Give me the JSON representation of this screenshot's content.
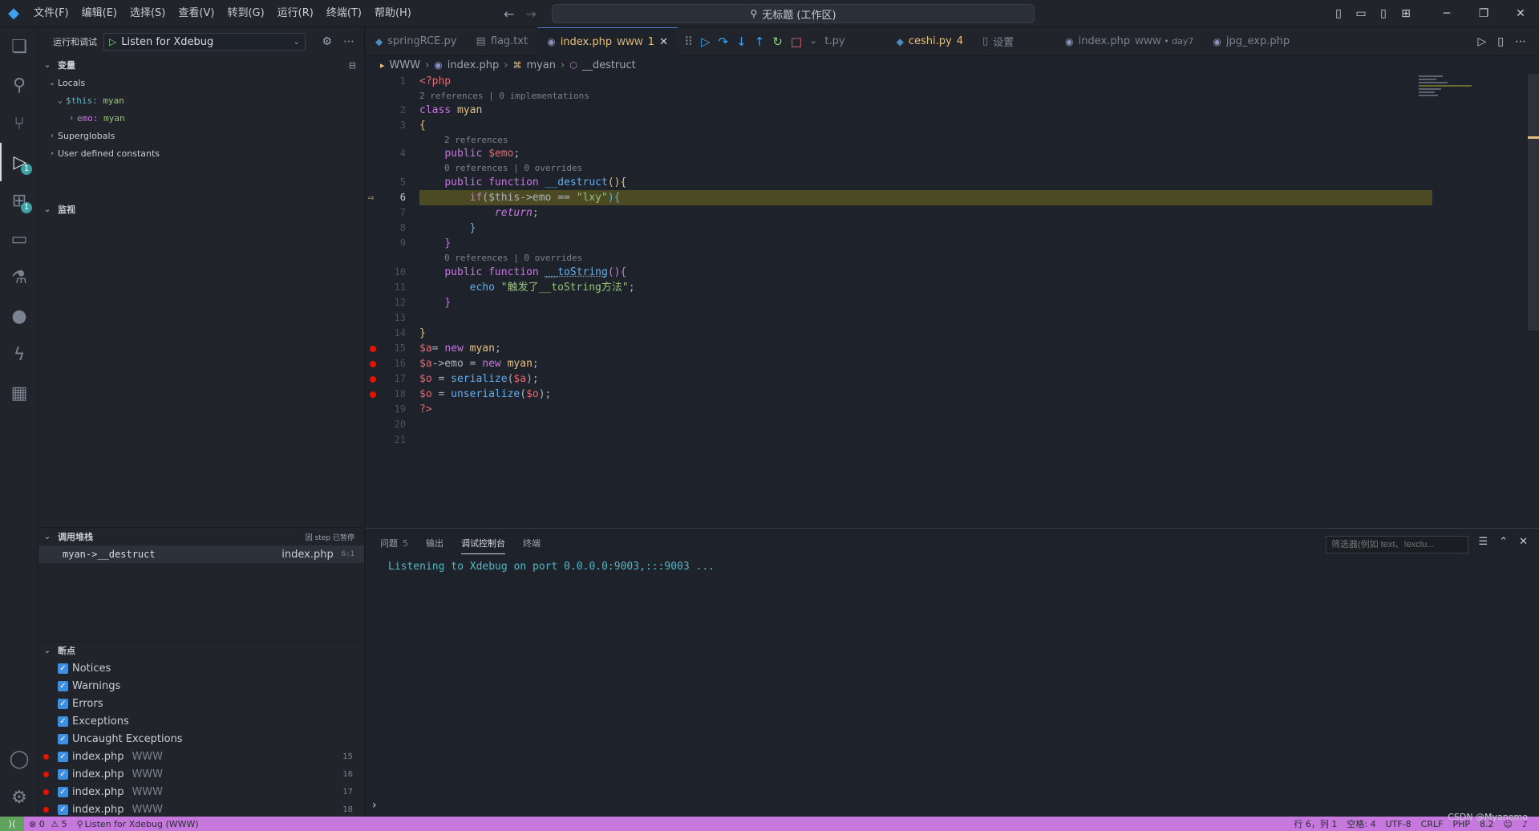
{
  "titlebar": {
    "menus": [
      "文件(F)",
      "编辑(E)",
      "选择(S)",
      "查看(V)",
      "转到(G)",
      "运行(R)",
      "终端(T)",
      "帮助(H)"
    ],
    "search": "无标题 (工作区)"
  },
  "activity": {
    "debug_badge": "1",
    "extensions_badge": "1"
  },
  "sidebar": {
    "title": "运行和调试",
    "config": "Listen for Xdebug",
    "variables_title": "变量",
    "locals": "Locals",
    "this_name": "$this:",
    "this_val": "myan",
    "emo_name": "emo:",
    "emo_val": "myan",
    "superglobals": "Superglobals",
    "user_constants": "User defined constants",
    "watch_title": "监视",
    "callstack_title": "调用堆栈",
    "callstack_status": "因 step 已暂停",
    "callstack_frame": "myan->__destruct",
    "callstack_file": "index.php",
    "callstack_pos": "6:1",
    "breakpoints_title": "断点",
    "breakpoints": [
      {
        "label": "Notices"
      },
      {
        "label": "Warnings"
      },
      {
        "label": "Errors"
      },
      {
        "label": "Exceptions"
      },
      {
        "label": "Uncaught Exceptions"
      }
    ],
    "file_breakpoints": [
      {
        "file": "index.php",
        "dir": "WWW",
        "line": "15"
      },
      {
        "file": "index.php",
        "dir": "WWW",
        "line": "16"
      },
      {
        "file": "index.php",
        "dir": "WWW",
        "line": "17"
      },
      {
        "file": "index.php",
        "dir": "WWW",
        "line": "18"
      }
    ]
  },
  "tabs": [
    {
      "label": "springRCE.py"
    },
    {
      "label": "flag.txt"
    },
    {
      "label": "index.php",
      "tag": "WWW",
      "num": "1"
    },
    {
      "label": "t.py"
    },
    {
      "label": "ceshi.py",
      "num": "4"
    },
    {
      "label": "设置"
    },
    {
      "label": "index.php",
      "tag": "WWW • day7"
    },
    {
      "label": "jpg_exp.php"
    }
  ],
  "breadcrumb": [
    "WWW",
    "index.php",
    "myan",
    "__destruct"
  ],
  "editor": {
    "lens": {
      "l1": "2 references | 0 implementations",
      "l4": "2 references",
      "l5": "0 references | 0 overrides",
      "l10": "0 references | 0 overrides"
    },
    "lines": {
      "n1": "1",
      "n2": "2",
      "n3": "3",
      "n4": "4",
      "n5": "5",
      "n6": "6",
      "n7": "7",
      "n8": "8",
      "n9": "9",
      "n10": "10",
      "n11": "11",
      "n12": "12",
      "n13": "13",
      "n14": "14",
      "n15": "15",
      "n16": "16",
      "n17": "17",
      "n18": "18",
      "n19": "19",
      "n20": "20",
      "n21": "21"
    },
    "code": {
      "c1": "<?php",
      "c2a": "class",
      "c2b": "myan",
      "c3": "{",
      "c4a": "public",
      "c4b": "$emo",
      "c4c": ";",
      "c5a": "public",
      "c5b": "function",
      "c5c": "__destruct",
      "c5d": "(){",
      "c6a": "if",
      "c6b": "($this",
      "c6c": "->emo == ",
      "c6d": "\"lxy\"",
      "c6e": "){",
      "c7a": "return",
      "c7b": ";",
      "c8": "}",
      "c9": "}",
      "c10a": "public",
      "c10b": "function",
      "c10c": "__toString",
      "c10d": "(){",
      "c11a": "echo",
      "c11b": "\"触发了__toString方法\"",
      "c11c": ";",
      "c12": "}",
      "c14": "}",
      "c15a": "$a",
      "c15b": "= ",
      "c15c": "new",
      "c15d": "myan",
      "c15e": ";",
      "c16a": "$a",
      "c16b": "->emo = ",
      "c16c": "new",
      "c16d": "myan",
      "c16e": ";",
      "c17a": "$o",
      "c17b": " = ",
      "c17c": "serialize",
      "c17d": "(",
      "c17e": "$a",
      "c17f": ");",
      "c18a": "$o",
      "c18b": " = ",
      "c18c": "unserialize",
      "c18d": "(",
      "c18e": "$o",
      "c18f": ");",
      "c19": "?>"
    }
  },
  "panel": {
    "tabs": [
      {
        "label": "问题",
        "count": "5"
      },
      {
        "label": "输出"
      },
      {
        "label": "调试控制台"
      },
      {
        "label": "终端"
      }
    ],
    "filter_placeholder": "筛选器(例如 text、!exclu...",
    "console": "Listening to Xdebug on port 0.0.0.0:9003,:::9003 ..."
  },
  "status": {
    "errors": "0",
    "warnings": "5",
    "debug": "Listen for Xdebug (WWW)",
    "position": "行 6，列 1",
    "spaces": "空格: 4",
    "encoding": "UTF-8",
    "eol": "CRLF",
    "language": "PHP",
    "version": "8.2"
  },
  "watermark": "CSDN @Myanemo"
}
